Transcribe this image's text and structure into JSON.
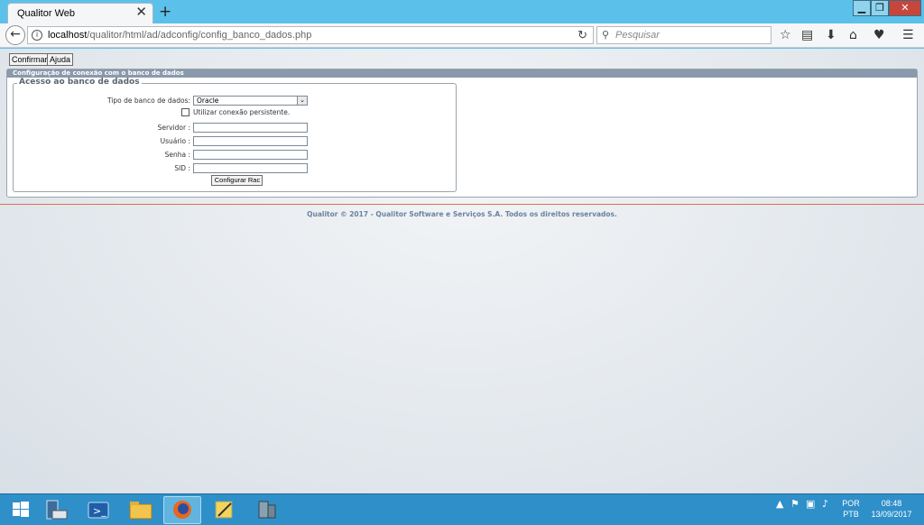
{
  "browser": {
    "tab_title": "Qualitor Web",
    "tab_close": "✕",
    "new_tab": "+",
    "url_host": "localhost",
    "url_path": "/qualitor/html/ad/adconfig/config_banco_dados.php",
    "search_placeholder": "Pesquisar",
    "window_min": "▁",
    "window_max": "❐",
    "window_close": "✕",
    "back_glyph": "←"
  },
  "toolbar": {
    "confirm_label": "Confirmar",
    "help_label": "Ajuda"
  },
  "panel": {
    "title": "Configuração de conexão com o banco de dados",
    "fieldset_legend": "Acesso ao banco de dados",
    "db_type_label": "Tipo de banco de dados:",
    "db_type_value": "Oracle",
    "persistent_label": "Utilizar conexão persistente.",
    "persistent_checked": false,
    "server_label": "Servidor :",
    "user_label": "Usuário :",
    "password_label": "Senha :",
    "sid_label": "SID :",
    "server_value": "",
    "user_value": "",
    "password_value": "",
    "sid_value": "",
    "rac_button": "Configurar Rac"
  },
  "footer": {
    "text": "Qualitor © 2017 - Qualitor Software e Serviços S.A. Todos os direitos reservados."
  },
  "taskbar": {
    "lang_top": "POR",
    "lang_bottom": "PTB",
    "time": "08:48",
    "date": "13/09/2017"
  },
  "colors": {
    "accent": "#5bc1ea",
    "panel_header": "#8a99ab",
    "footer_text": "#6b82a0",
    "divider": "#d8734f",
    "taskbar": "#2f8fc9"
  }
}
